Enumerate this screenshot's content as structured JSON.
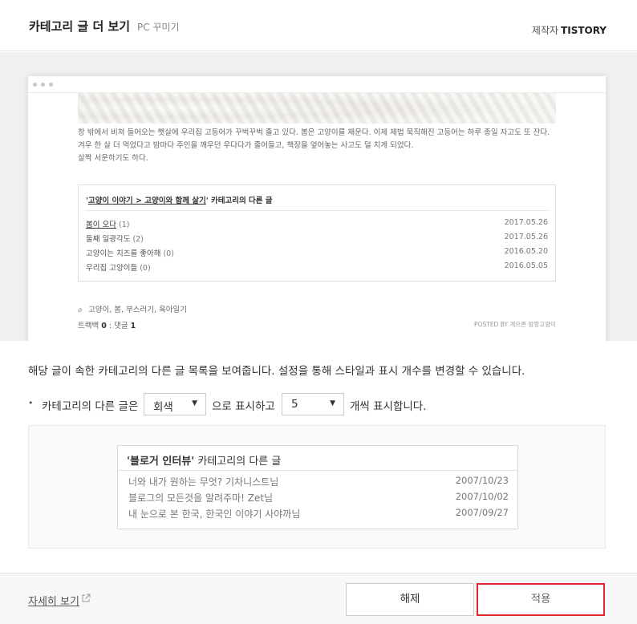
{
  "header": {
    "title": "카테고리 글 더 보기",
    "subtitle": "PC 꾸미기",
    "maker_label": "제작자",
    "maker_name": "TISTORY"
  },
  "preview": {
    "post_lines": [
      "창 밖에서 비쳐 들어오는 햇살에 우리집 고등어가 꾸벅꾸벅 졸고 있다. 봄은 고양이를 재운다. 이제 제법 묵직해진 고등어는 하루 종일 자고도 또 잔다.",
      "겨우 한 살 더 먹었다고 밤마다 주인을 깨우던 우다다가 줄어들고, 책장을 엎어놓는 사고도 덜 치게 되었다.",
      "살짝 서운하기도 하다."
    ],
    "related": {
      "quote_open": "'",
      "category_path": "고양이 이야기 > 고양이와 함께 살기",
      "suffix": "' 카테고리의 다른 글",
      "items": [
        {
          "title": "봄이 오다",
          "count": "(1)",
          "date": "2017.05.26"
        },
        {
          "title": "둘째 일광각도",
          "count": "(2)",
          "date": "2017.05.26"
        },
        {
          "title": "고양이는 치즈를 좋아해",
          "count": "(0)",
          "date": "2016.05.20"
        },
        {
          "title": "우리집 고양이들",
          "count": "(0)",
          "date": "2016.05.05"
        }
      ]
    },
    "tags": "고양이, 봄, 부스러기, 육아일기",
    "trackback_label": "트랙백",
    "trackback_count": "0",
    "comment_label": "댓글",
    "comment_count": "1",
    "posted_by": "POSTED BY 게으른 방랑고양이"
  },
  "description": "해당 글이 속한 카테고리의 다른 글 목록을 보여줍니다. 설정을 통해 스타일과 표시 개수를 변경할 수 있습니다.",
  "options": {
    "bullet": "•",
    "text_before": "카테고리의 다른 글은",
    "style_value": "회색",
    "text_middle": "으로 표시하고",
    "count_value": "5",
    "text_after": "개씩 표시합니다."
  },
  "example": {
    "heading_quoted": "'블로거 인터뷰'",
    "heading_suffix": " 카테고리의 다른 글",
    "items": [
      {
        "title": "너와 내가 원하는 무엇? 기차니스트님",
        "date": "2007/10/23"
      },
      {
        "title": "블로그의 모든것을 알려주마! Zet님",
        "date": "2007/10/02"
      },
      {
        "title": "내 눈으로 본 한국, 한국인 이야기 사야까님",
        "date": "2007/09/27"
      }
    ]
  },
  "footer": {
    "more_link": "자세히 보기",
    "cancel_label": "해제",
    "apply_label": "적용"
  },
  "colors": {
    "highlight_border": "#e1262e"
  }
}
